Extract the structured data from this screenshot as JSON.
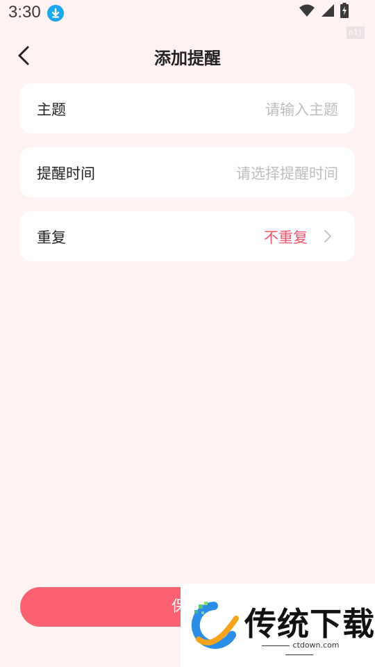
{
  "status_bar": {
    "time": "3:30",
    "icons": [
      "download-notification-icon",
      "wifi-icon",
      "signal-icon",
      "battery-charging-icon"
    ],
    "watermark_text": "n1j"
  },
  "header": {
    "title": "添加提醒",
    "back_icon": "chevron-left-icon"
  },
  "form": {
    "topic": {
      "label": "主题",
      "placeholder": "请输入主题"
    },
    "reminder_time": {
      "label": "提醒时间",
      "placeholder": "请选择提醒时间"
    },
    "repeat": {
      "label": "重复",
      "value": "不重复",
      "icon": "chevron-right-icon"
    }
  },
  "save_button": {
    "label": "保"
  },
  "overlay_watermark": {
    "brand": "传统下载",
    "url": "ctdown.com"
  },
  "colors": {
    "background": "#fff2f3",
    "card": "#ffffff",
    "accent": "#fa6272",
    "value_text": "#f05568",
    "placeholder": "#bdbdbd"
  }
}
